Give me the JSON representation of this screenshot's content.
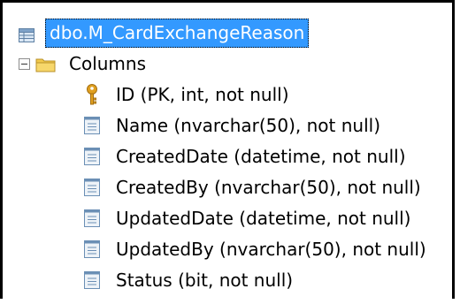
{
  "tree": {
    "table_name": "dbo.M_CardExchangeReason",
    "folder_label": "Columns",
    "columns": [
      {
        "label": "ID (PK, int, not null)",
        "icon": "key-icon"
      },
      {
        "label": "Name (nvarchar(50), not null)",
        "icon": "column-icon"
      },
      {
        "label": "CreatedDate (datetime, not null)",
        "icon": "column-icon"
      },
      {
        "label": "CreatedBy (nvarchar(50), not null)",
        "icon": "column-icon"
      },
      {
        "label": "UpdatedDate (datetime, not null)",
        "icon": "column-icon"
      },
      {
        "label": "UpdatedBy (nvarchar(50), not null)",
        "icon": "column-icon"
      },
      {
        "label": "Status (bit, not null)",
        "icon": "column-icon"
      }
    ],
    "colors": {
      "selection": "#3399ff",
      "folder": "#f2c94c",
      "key": "#e0a020",
      "column_icon": "#6b8fb5"
    }
  }
}
